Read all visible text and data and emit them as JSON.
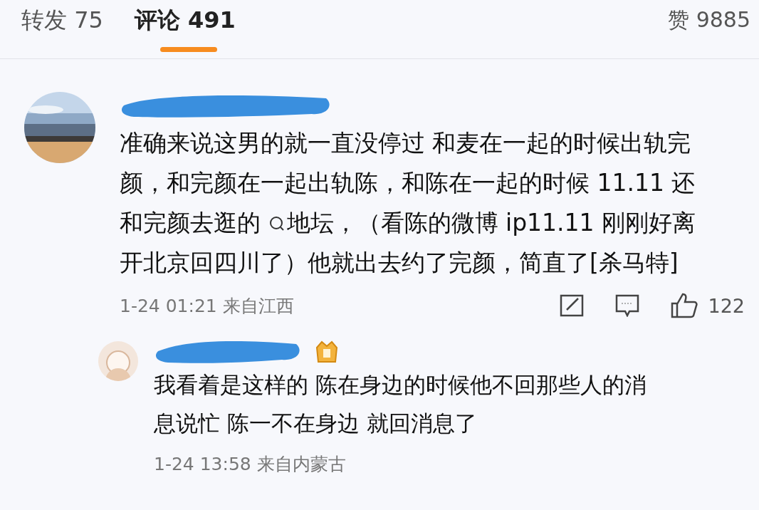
{
  "tabs": [
    {
      "label": "转发 75",
      "selected": false
    },
    {
      "label": "评论 491",
      "selected": true
    }
  ],
  "likes_total": "赞 9885",
  "comments": [
    {
      "avatar": {
        "kind": "picture"
      },
      "badge": false,
      "parts": [
        {
          "kind": "text",
          "text": "准确来说这男的就一直没停过 和麦在一起的时候出轨完颜，和完颜在一起出轨陈，和陈在一起的时候 11.11 还和完颜去逛的 "
        },
        {
          "kind": "search_link",
          "text": "地坛"
        },
        {
          "kind": "text",
          "text": "，（看陈的微博 ip11.11 刚刚好离开北京回四川了）他就出去约了完颜，简直了[杀马特]"
        }
      ],
      "meta": "1-24 01:21 来自江西",
      "like_count": "122",
      "replies": [
        {
          "avatar": {
            "kind": "cartoon"
          },
          "badge": true,
          "parts": [
            {
              "kind": "text",
              "text": "我看着是这样的 陈在身边的时候他不回那些人的消息说忙  陈一不在身边 就回消息了"
            }
          ],
          "meta": "1-24 13:58 来自内蒙古"
        }
      ]
    }
  ]
}
